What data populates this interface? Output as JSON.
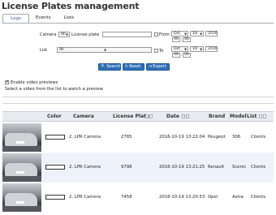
{
  "title": "License Plates management",
  "tabs": [
    {
      "label": "Logs",
      "active": true
    },
    {
      "label": "Events",
      "active": false
    },
    {
      "label": "Lists",
      "active": false
    }
  ],
  "filters": {
    "camera_label": "Camera",
    "camera_value": "All",
    "plate_label": "License plate",
    "plate_value": "",
    "list_label": "List",
    "list_value": "All",
    "from_label": "From",
    "to_label": "To",
    "from": {
      "month": "Oct",
      "day": "19",
      "year": "2016",
      "hour": "00",
      "minute": "00"
    },
    "to": {
      "month": "Oct",
      "day": "19",
      "year": "2016",
      "hour": "00",
      "minute": "00"
    }
  },
  "buttons": {
    "search": "Search",
    "reset": "Reset",
    "export": "Export"
  },
  "video": {
    "enable_label": "Enable video previews",
    "enabled": true,
    "hint": "Select a video from the list to watch a preview"
  },
  "table": {
    "columns": [
      "Color",
      "Camera",
      "License Plates",
      "Date",
      "Brand",
      "Model",
      "List"
    ],
    "rows": [
      {
        "color": "#ffffff",
        "camera": "2, LPR Camera",
        "plate": "2785",
        "date": "2016-10-19 13:22:04",
        "brand": "Peugeot",
        "model": "306",
        "list": "Clients"
      },
      {
        "color": "#ffffff",
        "camera": "2, LPR Camera",
        "plate": "9798",
        "date": "2016-10-19 13:21:25",
        "brand": "Renault",
        "model": "Scenic",
        "list": "Clients"
      },
      {
        "color": "#ffffff",
        "camera": "2, LPR Camera",
        "plate": "7458",
        "date": "2016-10-19 13:20:53",
        "brand": "Opel",
        "model": "Astra",
        "list": "Clients"
      }
    ]
  }
}
